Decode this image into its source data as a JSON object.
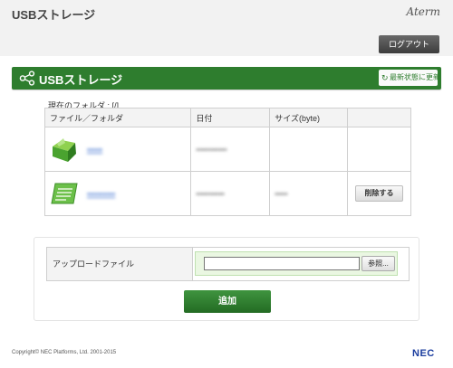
{
  "header": {
    "app_title": "USBストレージ",
    "brand": "Aterm",
    "logout_label": "ログアウト"
  },
  "section": {
    "title": "USBストレージ",
    "refresh_label": "最新状態に更新",
    "icon": "share-nodes-icon"
  },
  "folder": {
    "current_folder_label": "現在のフォルダ : [/]"
  },
  "table": {
    "columns": [
      "ファイル／フォルダ",
      "日付",
      "サイズ(byte)",
      ""
    ],
    "rows": [
      {
        "icon": "folder-icon",
        "name": "▪▪▪▪▪▪",
        "date": "▪▪▪▪▪▪▪▪▪▪▪▪",
        "size": "",
        "action": ""
      },
      {
        "icon": "file-icon",
        "name": "▪▪▪▪▪▪▪▪▪▪▪",
        "date": "▪▪▪▪▪▪▪▪▪▪▪",
        "size": "▪▪▪▪▪",
        "action": "削除する"
      }
    ]
  },
  "upload": {
    "label": "アップロードファイル",
    "browse_label": "参照...",
    "file_value": "",
    "add_label": "追加"
  },
  "footer": {
    "copyright": "Copyright© NEC Platforms, Ltd. 2001-2015",
    "logo": "NEC"
  },
  "colors": {
    "accent_green": "#2e7d2e",
    "link_blue": "#3a6ecf",
    "nec_blue": "#1a3c9e"
  }
}
